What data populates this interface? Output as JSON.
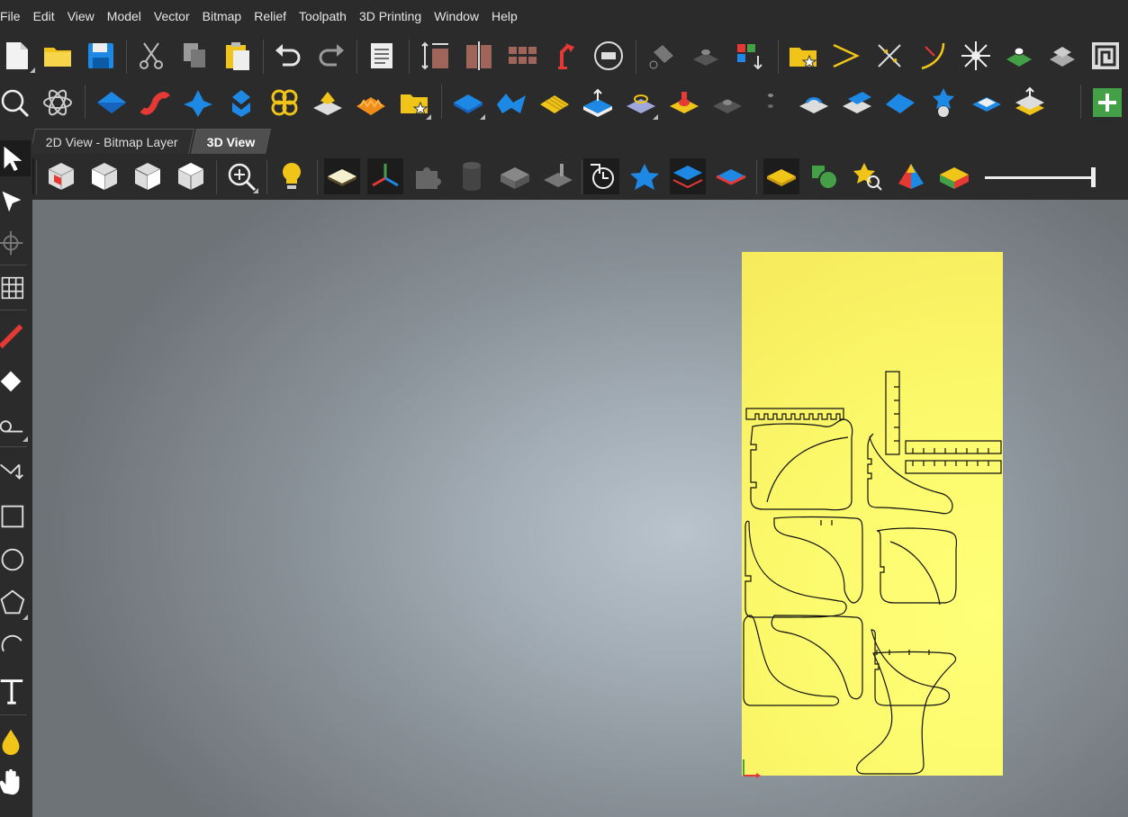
{
  "menu": [
    "File",
    "Edit",
    "View",
    "Model",
    "Vector",
    "Bitmap",
    "Relief",
    "Toolpath",
    "3D Printing",
    "Window",
    "Help"
  ],
  "toolbar1": [
    "new-file-icon",
    "open-folder-icon",
    "save-icon",
    "cut-icon",
    "copy-icon",
    "paste-icon",
    "undo-icon",
    "redo-icon",
    "notes-icon",
    "job-size-icon",
    "split-icon",
    "tiling-icon",
    "lamp-icon",
    "compass-icon",
    "fill-icon",
    "extrude-icon",
    "colored-blocks-icon",
    "favorite-folder-icon",
    "vector-angle-icon",
    "trim-icon",
    "curve-icon",
    "star-burst-icon",
    "component-icon",
    "merge-icon",
    "fret-icon"
  ],
  "toolbar2": [
    "zoom-icon",
    "atom-icon",
    "shape-blue-icon",
    "ribbon-icon",
    "spike-icon",
    "twist-icon",
    "weave-icon",
    "plate-icon",
    "texture-icon",
    "clipart-folder-icon",
    "layer-blue-icon",
    "wave-icon",
    "planks-icon",
    "raise-icon",
    "stamp-icon",
    "button-icon",
    "dome-icon",
    "dot-icon",
    "pin-icon",
    "stack-icon",
    "slab-icon",
    "blue-star-icon",
    "flat-icon",
    "layers-icon",
    "add-component-icon"
  ],
  "tabs": [
    "2D View - Bitmap Layer",
    "3D View"
  ],
  "view_toolbar": [
    "select-icon",
    "iso-view-icon",
    "front-view-icon",
    "side-view-icon",
    "top-view-icon",
    "zoom-fit-icon",
    "lighting-icon",
    "material-icon",
    "axes-icon",
    "puzzle-icon",
    "cylinder-icon",
    "block-icon",
    "router-icon",
    "clock-icon",
    "star-relief-icon",
    "layer-show-icon",
    "layer-red-icon",
    "sheet-icon",
    "shapes-icon",
    "star-search-icon",
    "pyramid-icon",
    "colormap-icon"
  ],
  "left_toolbar": [
    "select-arrow-icon",
    "node-edit-icon",
    "transform-icon",
    "grid-icon",
    "pencil-icon",
    "eraser-icon",
    "measure-icon",
    "trim-vector-icon",
    "rectangle-icon",
    "circle-icon",
    "polygon-icon",
    "arc-icon",
    "text-icon",
    "drop-icon",
    "hand-icon"
  ],
  "slider": {
    "value": 1.0
  },
  "colors": {
    "menu_bg": "#2b2b2b",
    "sheet": "#ffff78",
    "accent_blue": "#1e88e5"
  }
}
